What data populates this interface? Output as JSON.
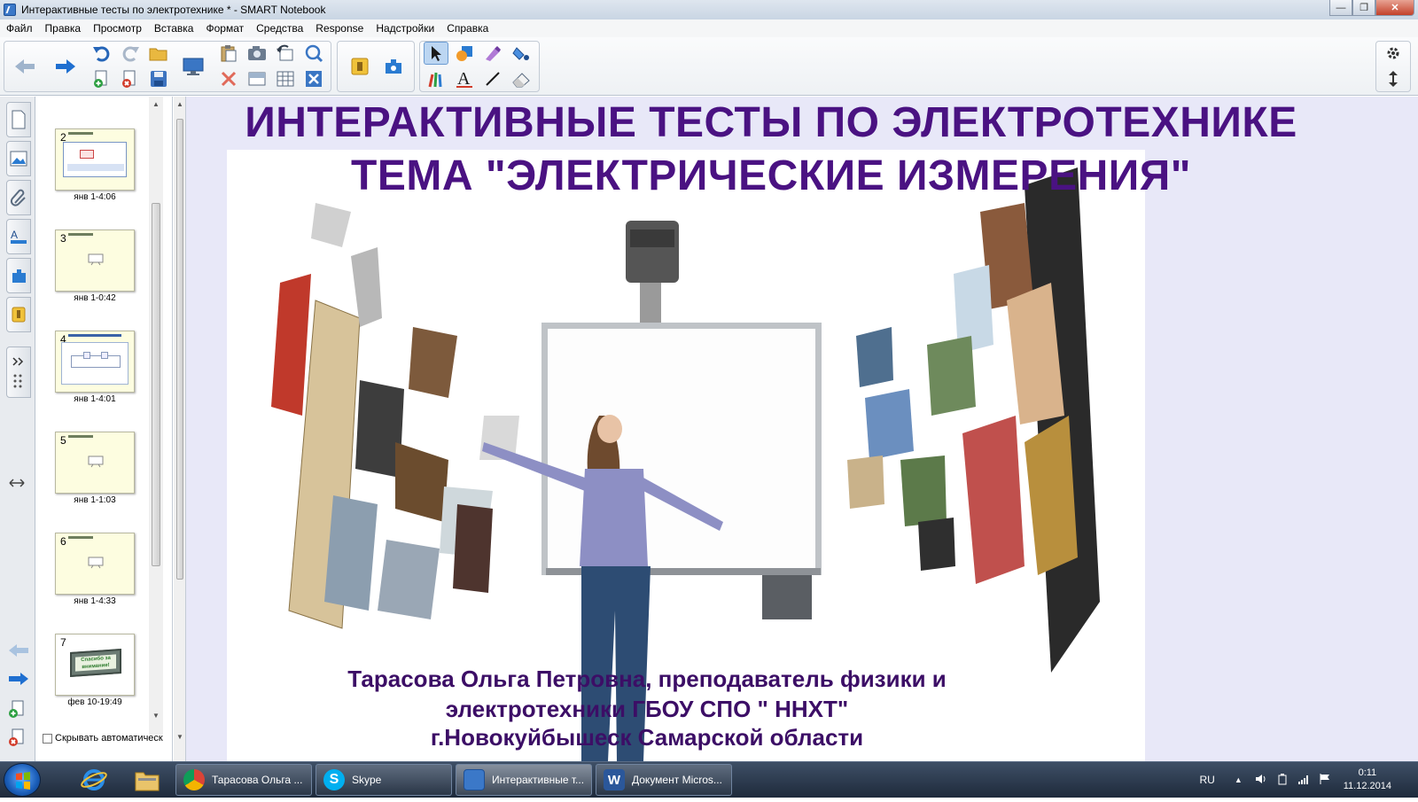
{
  "window": {
    "title": "Интерактивные тесты по электротехнике * - SMART Notebook"
  },
  "menu": [
    "Файл",
    "Правка",
    "Просмотр",
    "Вставка",
    "Формат",
    "Средства",
    "Response",
    "Надстройки",
    "Справка"
  ],
  "toolbar": {
    "icons": [
      "back-icon",
      "forward-icon",
      "undo-icon",
      "redo-icon",
      "open-icon",
      "add-page-icon",
      "delete-page-icon",
      "save-icon",
      "screen-icon",
      "paste-icon",
      "camera-icon",
      "reset-icon",
      "delete-icon",
      "screen-shade-icon",
      "table-icon",
      "capture-icon",
      "close-icon",
      "document-camera-icon",
      "response-icon",
      "select-icon",
      "shapes-icon",
      "magic-pen-icon",
      "fill-icon",
      "pens-icon",
      "text-icon",
      "line-icon",
      "eraser-icon",
      "settings-icon",
      "move-toolbar-icon"
    ]
  },
  "sidebar": {
    "tabs": [
      "page-sorter-icon",
      "gallery-icon",
      "attachments-icon",
      "properties-icon",
      "addons-icon",
      "response-icon"
    ],
    "pages": [
      {
        "number": "2",
        "time": "янв 1-4:06"
      },
      {
        "number": "3",
        "time": "янв 1-0:42"
      },
      {
        "number": "4",
        "time": "янв 1-4:01"
      },
      {
        "number": "5",
        "time": "янв 1-1:03"
      },
      {
        "number": "6",
        "time": "янв 1-4:33"
      },
      {
        "number": "7",
        "time": "фев 10-19:49"
      }
    ],
    "thumb7_text": "Спасибо за внимание!",
    "autohide_label": "Скрывать автоматическ"
  },
  "slide": {
    "title_line1": "ИНТЕРАКТИВНЫЕ ТЕСТЫ ПО ЭЛЕКТРОТЕХНИКЕ",
    "title_line2": "ТЕМА \"ЭЛЕКТРИЧЕСКИЕ ИЗМЕРЕНИЯ\"",
    "author_line1": "Тарасова Ольга Петровна, преподаватель физики и",
    "author_line2": "электротехники ГБОУ СПО \" ННХТ\"",
    "author_line3": "г.Новокуйбышеск Самарской области",
    "title_color": "#4a1282"
  },
  "taskbar": {
    "tasks": [
      {
        "label": "Тарасова Ольга ...",
        "icon": "chrome-icon"
      },
      {
        "label": "Skype",
        "icon": "skype-icon"
      },
      {
        "label": "Интерактивные т...",
        "icon": "smart-notebook-icon",
        "active": true
      },
      {
        "label": "Документ Micros...",
        "icon": "word-icon"
      }
    ],
    "language": "RU",
    "time": "0:11",
    "date": "11.12.2014"
  }
}
